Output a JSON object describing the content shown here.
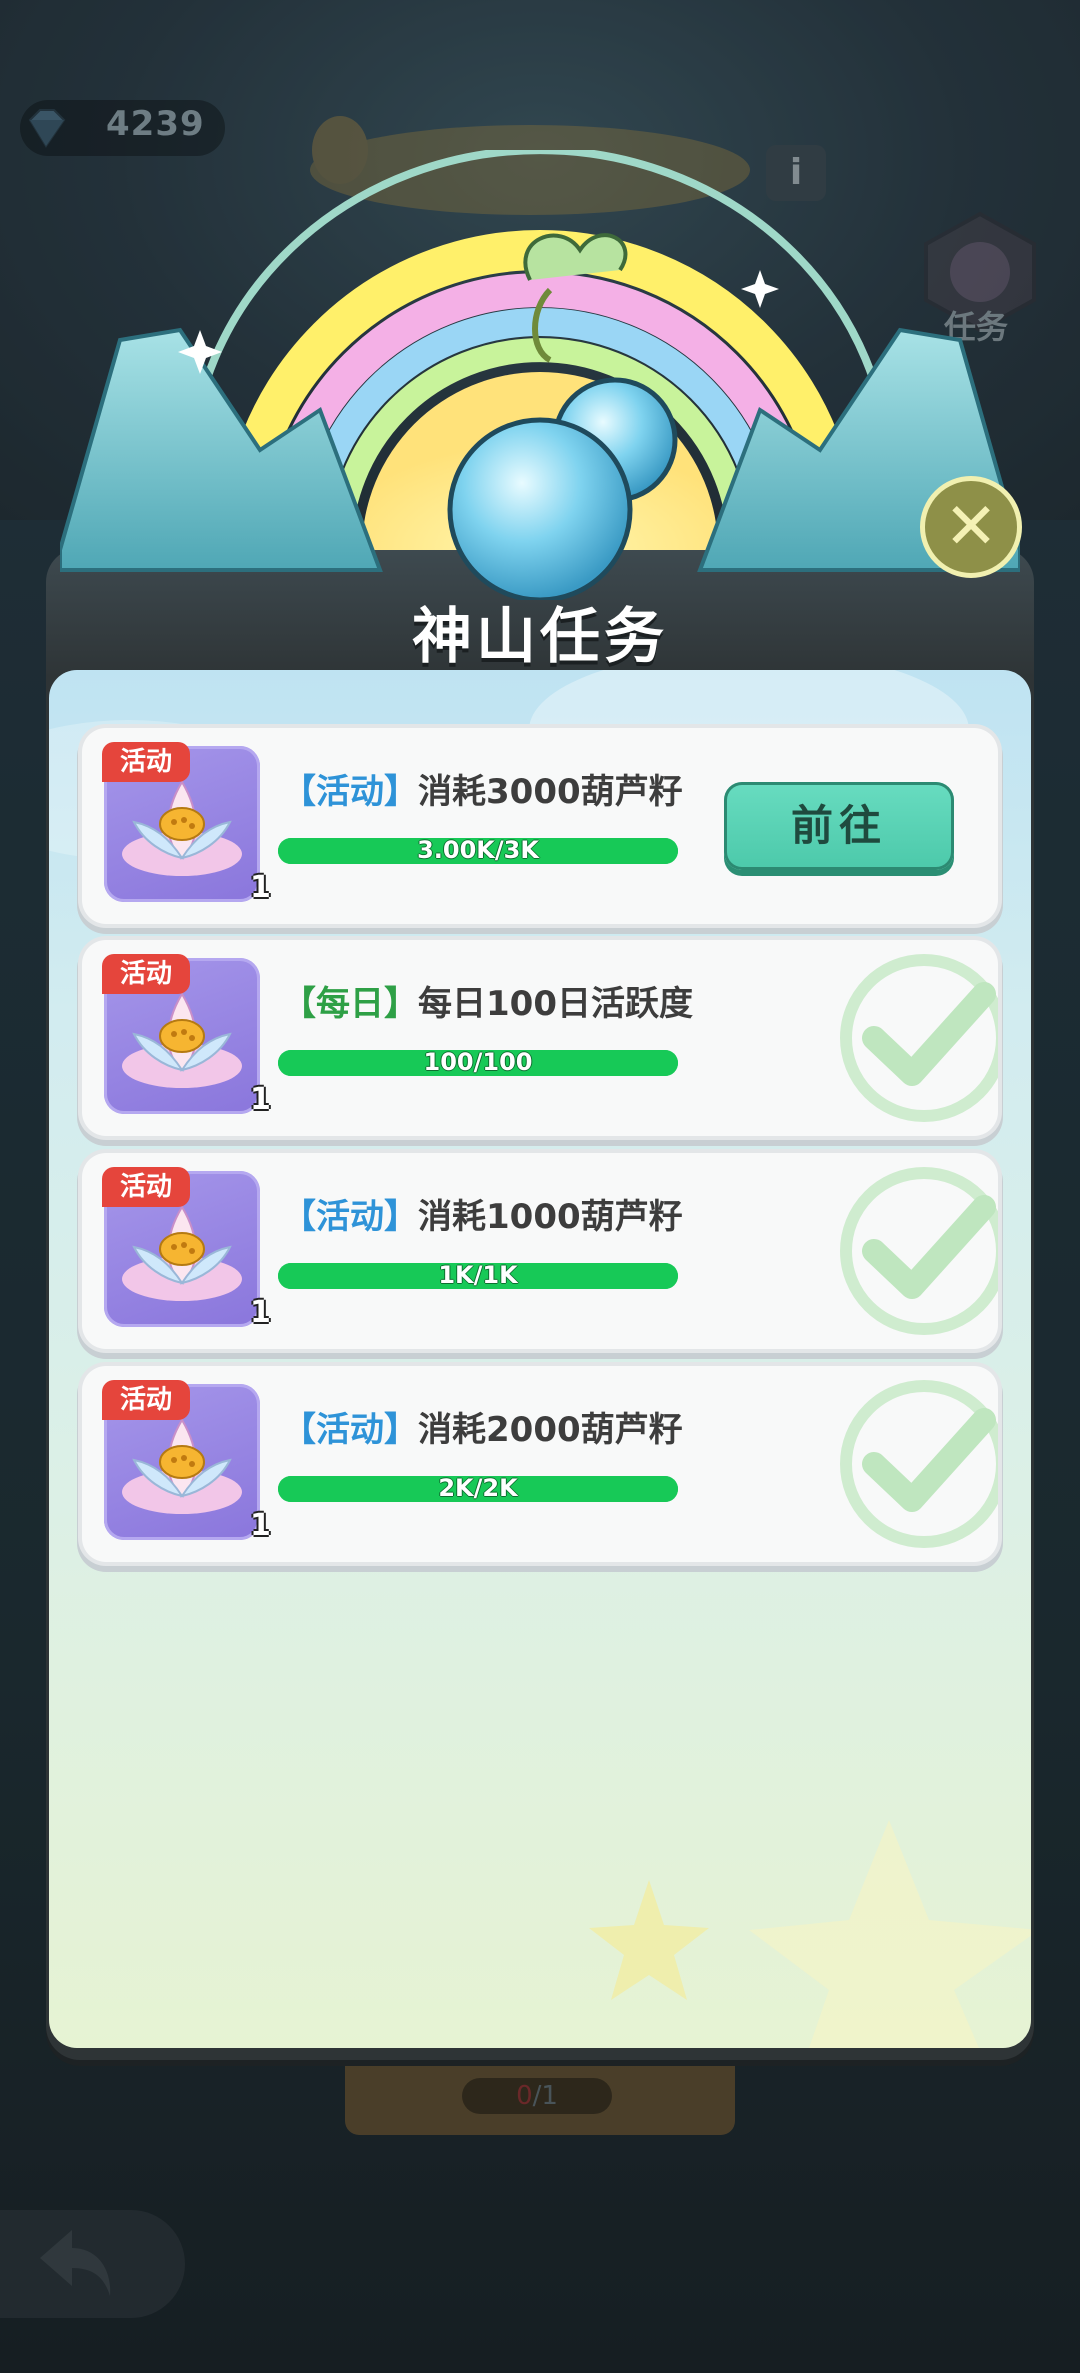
{
  "header": {
    "gem_count": "4239",
    "task_hex_label": "任务",
    "info_label": "i"
  },
  "modal": {
    "title": "神山任务",
    "close_label": "✕"
  },
  "tasks": [
    {
      "tag": "活动",
      "category": "【活动】",
      "category_type": "event",
      "name": "消耗3000葫芦籽",
      "progress_text": "3.00K/3K",
      "progress": 1.0,
      "reward_qty": "1",
      "action": "前往",
      "completed": false
    },
    {
      "tag": "活动",
      "category": "【每日】",
      "category_type": "daily",
      "name": "每日100日活跃度",
      "progress_text": "100/100",
      "progress": 1.0,
      "reward_qty": "1",
      "action": "",
      "completed": true
    },
    {
      "tag": "活动",
      "category": "【活动】",
      "category_type": "event",
      "name": "消耗1000葫芦籽",
      "progress_text": "1K/1K",
      "progress": 1.0,
      "reward_qty": "1",
      "action": "",
      "completed": true
    },
    {
      "tag": "活动",
      "category": "【活动】",
      "category_type": "event",
      "name": "消耗2000葫芦籽",
      "progress_text": "2K/2K",
      "progress": 1.0,
      "reward_qty": "1",
      "action": "",
      "completed": true
    }
  ],
  "bottom": {
    "count_have": "0",
    "count_sep": "/",
    "count_total": "1"
  },
  "colors": {
    "progress_green": "#17c957",
    "event_blue": "#2e93d8",
    "daily_green": "#2ea046",
    "go_button": "#4cc9aa",
    "tag_red": "#e5453c"
  }
}
